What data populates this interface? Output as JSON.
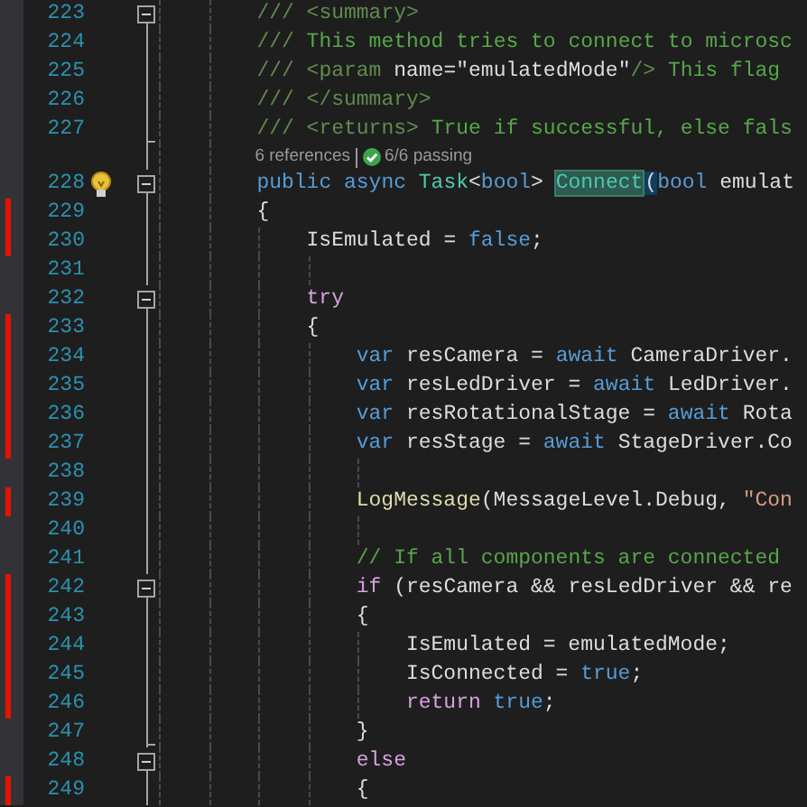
{
  "editor": {
    "lines": [
      {
        "number": "223",
        "changed": false,
        "bulb": false,
        "fold_start": true,
        "fold_end": false,
        "tokens": [
          {
            "kind": "doc",
            "text": "/// <summary>"
          }
        ]
      },
      {
        "number": "224",
        "changed": false,
        "bulb": false,
        "fold_start": false,
        "fold_end": false,
        "tokens": [
          {
            "kind": "doc",
            "text": "/// "
          },
          {
            "kind": "comment",
            "text": "This method tries to connect to microsc"
          }
        ]
      },
      {
        "number": "225",
        "changed": false,
        "bulb": false,
        "fold_start": false,
        "fold_end": false,
        "tokens": [
          {
            "kind": "doc",
            "text": "/// <param "
          },
          {
            "kind": "plain",
            "text": "name=\"emulatedMode\""
          },
          {
            "kind": "doc",
            "text": "/> "
          },
          {
            "kind": "comment",
            "text": "This flag"
          }
        ]
      },
      {
        "number": "226",
        "changed": false,
        "bulb": false,
        "fold_start": false,
        "fold_end": false,
        "tokens": [
          {
            "kind": "doc",
            "text": "/// </summary>"
          }
        ]
      },
      {
        "number": "227",
        "changed": false,
        "bulb": false,
        "fold_start": false,
        "fold_end": true,
        "tokens": [
          {
            "kind": "doc",
            "text": "/// <returns> "
          },
          {
            "kind": "comment",
            "text": "True if successful, else fals"
          }
        ]
      }
    ],
    "codelens": {
      "references": "6 references",
      "tests": "6/6 passing"
    },
    "lines_after": [
      {
        "number": "228",
        "changed": false,
        "bulb": true,
        "fold_start": true,
        "fold_end": false,
        "tokens": [
          {
            "kind": "keyword",
            "text": "public async "
          },
          {
            "kind": "type",
            "text": "Task"
          },
          {
            "kind": "plain",
            "text": "<"
          },
          {
            "kind": "keyword",
            "text": "bool"
          },
          {
            "kind": "plain",
            "text": "> "
          },
          {
            "kind": "highlight",
            "text": "Connect"
          },
          {
            "kind": "brace",
            "text": "("
          },
          {
            "kind": "keyword",
            "text": "bool "
          },
          {
            "kind": "plain",
            "text": "emulat"
          }
        ]
      },
      {
        "number": "229",
        "changed": true,
        "bulb": false,
        "fold_start": false,
        "fold_end": false,
        "tokens": [
          {
            "kind": "plain",
            "text": "{"
          }
        ],
        "children": [
          {
            "number": "230",
            "changed": true,
            "bulb": false,
            "fold_start": false,
            "fold_end": false,
            "tokens": [
              {
                "kind": "plain",
                "text": "IsEmulated = "
              },
              {
                "kind": "keyword",
                "text": "false"
              },
              {
                "kind": "plain",
                "text": ";"
              }
            ]
          },
          {
            "number": "231",
            "changed": false,
            "bulb": false,
            "fold_start": false,
            "fold_end": false
          },
          {
            "number": "232",
            "changed": false,
            "bulb": false,
            "fold_start": true,
            "fold_end": false,
            "tokens": [
              {
                "kind": "control",
                "text": "try"
              }
            ]
          },
          {
            "number": "233",
            "changed": true,
            "bulb": false,
            "fold_start": false,
            "fold_end": false,
            "tokens": [
              {
                "kind": "plain",
                "text": "{"
              }
            ],
            "children": [
              {
                "number": "234",
                "changed": true,
                "bulb": false,
                "fold_start": false,
                "fold_end": false,
                "tokens": [
                  {
                    "kind": "keyword",
                    "text": "var "
                  },
                  {
                    "kind": "plain",
                    "text": "resCamera = "
                  },
                  {
                    "kind": "keyword",
                    "text": "await "
                  },
                  {
                    "kind": "plain",
                    "text": "CameraDriver."
                  }
                ]
              },
              {
                "number": "235",
                "changed": true,
                "bulb": false,
                "fold_start": false,
                "fold_end": false,
                "tokens": [
                  {
                    "kind": "keyword",
                    "text": "var "
                  },
                  {
                    "kind": "plain",
                    "text": "resLedDriver = "
                  },
                  {
                    "kind": "keyword",
                    "text": "await "
                  },
                  {
                    "kind": "plain",
                    "text": "LedDriver."
                  }
                ]
              },
              {
                "number": "236",
                "changed": true,
                "bulb": false,
                "fold_start": false,
                "fold_end": false,
                "tokens": [
                  {
                    "kind": "keyword",
                    "text": "var "
                  },
                  {
                    "kind": "plain",
                    "text": "resRotationalStage = "
                  },
                  {
                    "kind": "keyword",
                    "text": "await "
                  },
                  {
                    "kind": "plain",
                    "text": "Rota"
                  }
                ]
              },
              {
                "number": "237",
                "changed": true,
                "bulb": false,
                "fold_start": false,
                "fold_end": false,
                "tokens": [
                  {
                    "kind": "keyword",
                    "text": "var "
                  },
                  {
                    "kind": "plain",
                    "text": "resStage = "
                  },
                  {
                    "kind": "keyword",
                    "text": "await "
                  },
                  {
                    "kind": "plain",
                    "text": "StageDriver.Co"
                  }
                ]
              },
              {
                "number": "238",
                "changed": false,
                "bulb": false,
                "fold_start": false,
                "fold_end": false
              },
              {
                "number": "239",
                "changed": true,
                "bulb": false,
                "fold_start": false,
                "fold_end": false,
                "tokens": [
                  {
                    "kind": "method",
                    "text": "LogMessage"
                  },
                  {
                    "kind": "plain",
                    "text": "(MessageLevel.Debug, "
                  },
                  {
                    "kind": "string",
                    "text": "\"Con"
                  }
                ]
              },
              {
                "number": "240",
                "changed": false,
                "bulb": false,
                "fold_start": false,
                "fold_end": false
              },
              {
                "number": "241",
                "changed": false,
                "bulb": false,
                "fold_start": false,
                "fold_end": false,
                "tokens": [
                  {
                    "kind": "comment",
                    "text": "// If all components are connected"
                  }
                ]
              },
              {
                "number": "242",
                "changed": true,
                "bulb": false,
                "fold_start": true,
                "fold_end": false,
                "tokens": [
                  {
                    "kind": "control",
                    "text": "if "
                  },
                  {
                    "kind": "plain",
                    "text": "(resCamera && resLedDriver && re"
                  }
                ]
              },
              {
                "number": "243",
                "changed": true,
                "bulb": false,
                "fold_start": false,
                "fold_end": false,
                "tokens": [
                  {
                    "kind": "plain",
                    "text": "{"
                  }
                ],
                "children": [
                  {
                    "number": "244",
                    "changed": true,
                    "bulb": false,
                    "fold_start": false,
                    "fold_end": false,
                    "tokens": [
                      {
                        "kind": "plain",
                        "text": "IsEmulated = emulatedMode;"
                      }
                    ]
                  },
                  {
                    "number": "245",
                    "changed": true,
                    "bulb": false,
                    "fold_start": false,
                    "fold_end": false,
                    "tokens": [
                      {
                        "kind": "plain",
                        "text": "IsConnected = "
                      },
                      {
                        "kind": "keyword",
                        "text": "true"
                      },
                      {
                        "kind": "plain",
                        "text": ";"
                      }
                    ]
                  },
                  {
                    "number": "246",
                    "changed": true,
                    "bulb": false,
                    "fold_start": false,
                    "fold_end": false,
                    "tokens": [
                      {
                        "kind": "control",
                        "text": "return "
                      },
                      {
                        "kind": "keyword",
                        "text": "true"
                      },
                      {
                        "kind": "plain",
                        "text": ";"
                      }
                    ]
                  }
                ]
              },
              {
                "number": "247",
                "changed": false,
                "bulb": false,
                "fold_start": false,
                "fold_end": true,
                "tokens": [
                  {
                    "kind": "plain",
                    "text": "}"
                  }
                ]
              },
              {
                "number": "248",
                "changed": false,
                "bulb": false,
                "fold_start": true,
                "fold_end": false,
                "tokens": [
                  {
                    "kind": "control",
                    "text": "else"
                  }
                ]
              },
              {
                "number": "249",
                "changed": true,
                "bulb": false,
                "fold_start": false,
                "fold_end": false,
                "tokens": [
                  {
                    "kind": "plain",
                    "text": "{"
                  }
                ]
              }
            ]
          }
        ]
      }
    ]
  }
}
